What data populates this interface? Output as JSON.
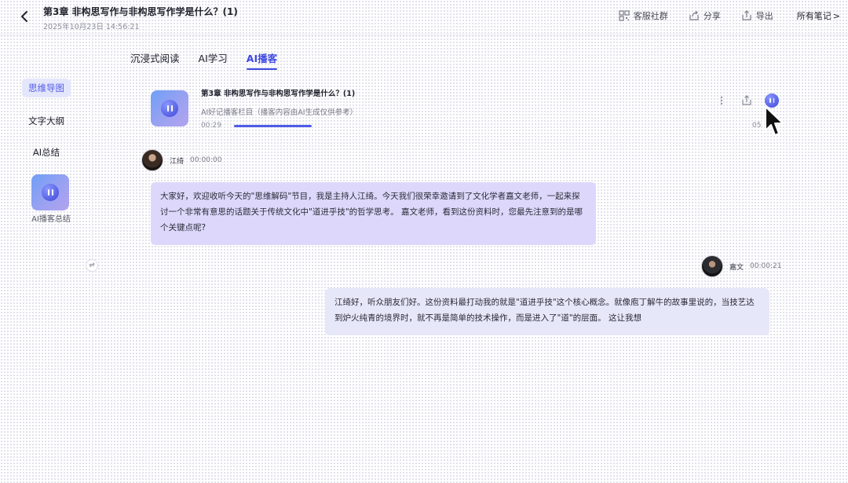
{
  "header": {
    "title": "第3章 非构思写作与非构思写作学是什么？(1)",
    "time": "2025年10月23日 14:56:21",
    "actions": [
      {
        "label": "客服社群",
        "icon": "qrcode-icon"
      },
      {
        "label": "分享",
        "icon": "share-icon"
      },
      {
        "label": "导出",
        "icon": "export-icon"
      }
    ],
    "all_notes": "所有笔记",
    "chevron": ">"
  },
  "sidebar": {
    "items": [
      {
        "label": "思维导图",
        "active": true
      },
      {
        "label": "文字大纲",
        "active": false
      },
      {
        "label": "AI总结",
        "active": false
      }
    ],
    "podcast_label": "AI播客总结",
    "swap_icon": "⇌"
  },
  "tabs": [
    {
      "label": "沉浸式阅读",
      "active": false
    },
    {
      "label": "AI学习",
      "active": false
    },
    {
      "label": "AI播客",
      "active": true
    }
  ],
  "player": {
    "title": "第3章 非构思写作与非构思写作学是什么？(1)",
    "subtitle": "AI好记播客栏目（播客内容由AI生成仅供参考）",
    "current_time": "00:29",
    "total_time": "05",
    "progress": 0.15,
    "accent": "#4f5be8"
  },
  "dialogue": [
    {
      "speaker": "江绮",
      "time": "00:00:00",
      "text": "大家好，欢迎收听今天的\"思维解码\"节目，我是主持人江绮。今天我们很荣幸邀请到了文化学者嘉文老师，一起来探讨一个非常有意思的话题关于传统文化中\"道进乎技\"的哲学思考。 嘉文老师，看到这份资料时，您最先注意到的是哪个关键点呢?"
    },
    {
      "speaker": "嘉文",
      "time": "00:00:21",
      "text": "江绮好，听众朋友们好。这份资料最打动我的就是\"道进乎技\"这个核心概念。就像庖丁解牛的故事里说的，当技艺达到炉火纯青的境界时，就不再是简单的技术操作，而是进入了\"道\"的层面。 这让我想"
    }
  ]
}
